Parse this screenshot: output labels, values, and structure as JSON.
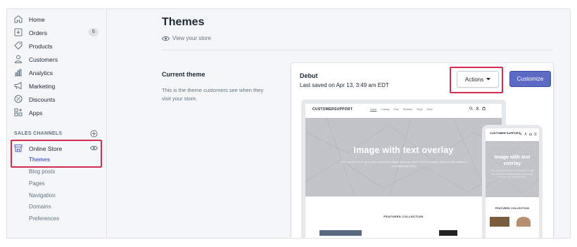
{
  "sidebar": {
    "items": [
      {
        "label": "Home",
        "icon": "home-icon"
      },
      {
        "label": "Orders",
        "icon": "orders-icon",
        "badge": "6"
      },
      {
        "label": "Products",
        "icon": "tag-icon"
      },
      {
        "label": "Customers",
        "icon": "person-icon"
      },
      {
        "label": "Analytics",
        "icon": "bar-chart-icon"
      },
      {
        "label": "Marketing",
        "icon": "megaphone-icon"
      },
      {
        "label": "Discounts",
        "icon": "discount-icon"
      },
      {
        "label": "Apps",
        "icon": "apps-icon"
      }
    ],
    "sales_channels_heading": "SALES CHANNELS",
    "online_store": {
      "label": "Online Store",
      "sub_items": [
        "Themes",
        "Blog posts",
        "Pages",
        "Navigation",
        "Domains",
        "Preferences"
      ],
      "active": "Themes"
    }
  },
  "main": {
    "title": "Themes",
    "view_store": "View your store",
    "current_theme_title": "Current theme",
    "current_theme_desc": "This is the theme customers see when they visit your store."
  },
  "theme_card": {
    "name": "Debut",
    "saved": "Last saved on Apr 13, 3:49 am EDT",
    "actions_label": "Actions",
    "customize_label": "Customize"
  },
  "preview": {
    "store_logo": "CUSTOMERSUPPORT",
    "mobile_logo": "CUSTOMER SUPPORT",
    "nav_links": [
      "Home",
      "Catalog",
      "Files",
      "Reviews",
      "FAQs",
      "More"
    ],
    "hero_title": "Image with text overlay",
    "hero_sub": "Use overlay text to give your customers insight into your brand. Select imagery and text that relates to your style and story.",
    "featured": "FEATURED COLLECTION"
  },
  "colors": {
    "accent": "#5c6ac4",
    "highlight": "#d52b4f",
    "sidebar_bg": "#f4f6f8"
  }
}
